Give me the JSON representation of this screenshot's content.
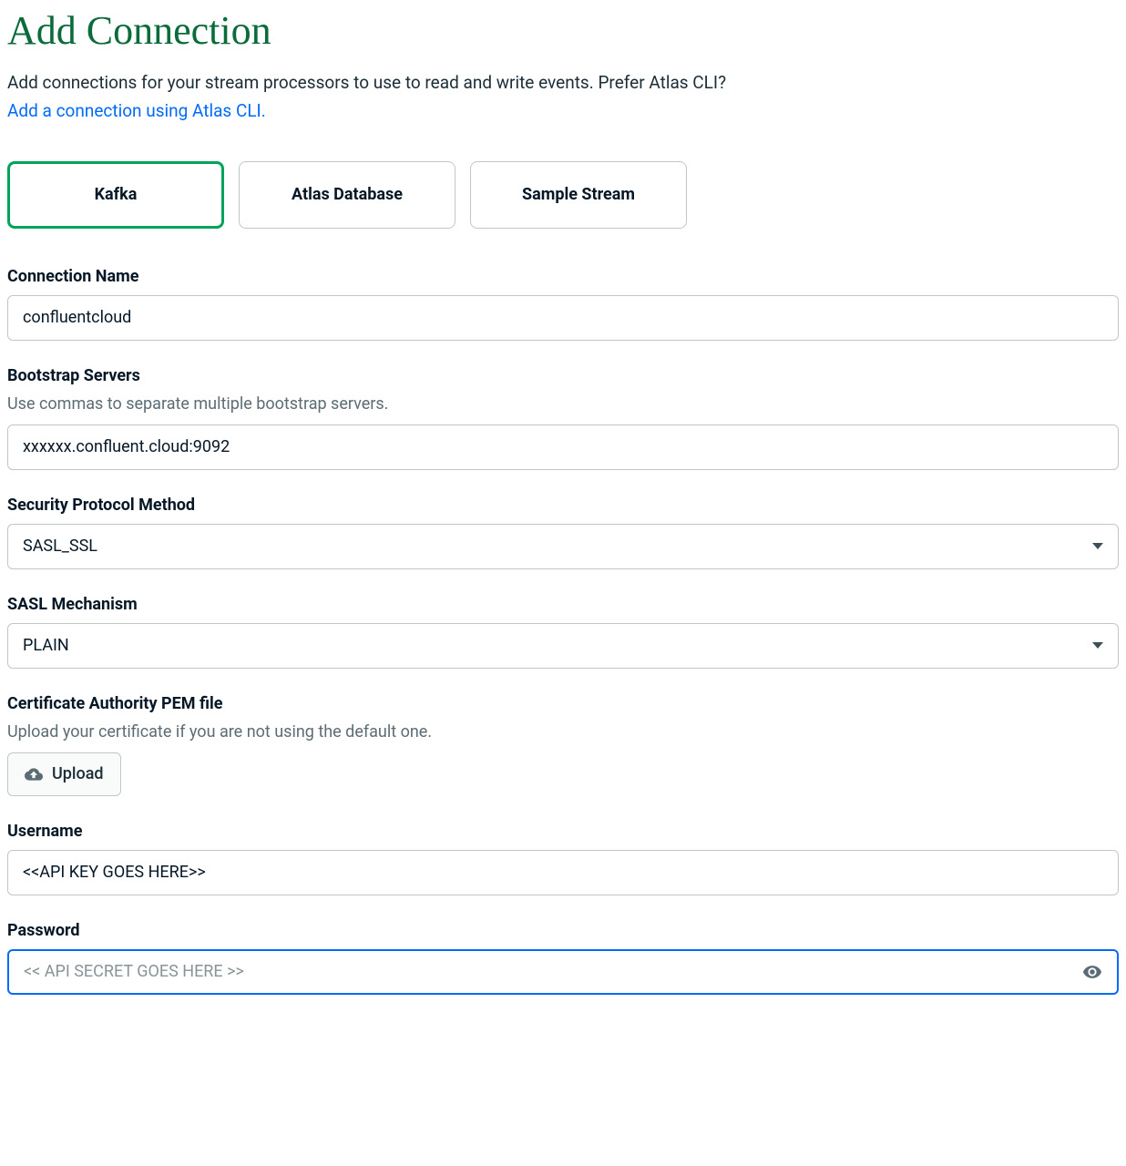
{
  "header": {
    "title": "Add Connection",
    "description": "Add connections for your stream processors to use to read and write events. Prefer Atlas CLI?",
    "link_text": "Add a connection using Atlas CLI."
  },
  "tabs": [
    {
      "label": "Kafka",
      "active": true
    },
    {
      "label": "Atlas Database",
      "active": false
    },
    {
      "label": "Sample Stream",
      "active": false
    }
  ],
  "form": {
    "connection_name": {
      "label": "Connection Name",
      "value": "confluentcloud"
    },
    "bootstrap_servers": {
      "label": "Bootstrap Servers",
      "hint": "Use commas to separate multiple bootstrap servers.",
      "value": "xxxxxx.confluent.cloud:9092"
    },
    "security_protocol": {
      "label": "Security Protocol Method",
      "value": "SASL_SSL"
    },
    "sasl_mechanism": {
      "label": "SASL Mechanism",
      "value": "PLAIN"
    },
    "ca_pem": {
      "label": "Certificate Authority PEM file",
      "hint": "Upload your certificate if you are not using the default one.",
      "button": "Upload"
    },
    "username": {
      "label": "Username",
      "value": "<<API KEY GOES HERE>>"
    },
    "password": {
      "label": "Password",
      "placeholder": "<< API SECRET GOES HERE >>"
    }
  }
}
